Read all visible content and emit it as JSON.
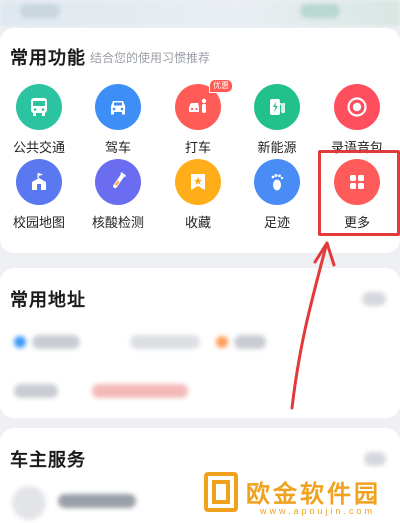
{
  "functions": {
    "title": "常用功能",
    "subtitle": "结合您的使用习惯推荐",
    "items": [
      {
        "label": "公共交通",
        "icon": "bus-icon",
        "color": "#2cc4a0"
      },
      {
        "label": "驾车",
        "icon": "car-icon",
        "color": "#3d8ef7"
      },
      {
        "label": "打车",
        "icon": "taxi-icon",
        "color": "#ff5b57",
        "badge": "优惠"
      },
      {
        "label": "新能源",
        "icon": "charging-icon",
        "color": "#22c08a"
      },
      {
        "label": "录语音包",
        "icon": "record-icon",
        "color": "#ff4f5e"
      },
      {
        "label": "校园地图",
        "icon": "campus-icon",
        "color": "#5a78f0"
      },
      {
        "label": "核酸检测",
        "icon": "test-tube-icon",
        "color": "#6b6df0"
      },
      {
        "label": "收藏",
        "icon": "star-icon",
        "color": "#ffae1a"
      },
      {
        "label": "足迹",
        "icon": "footprint-icon",
        "color": "#4a8cf5"
      },
      {
        "label": "更多",
        "icon": "grid-more-icon",
        "color": "#ff5b5b"
      }
    ]
  },
  "address": {
    "title": "常用地址"
  },
  "car_service": {
    "title": "车主服务"
  },
  "watermark": {
    "brand": "欧金软件园",
    "url": "www.apoujin.com"
  }
}
